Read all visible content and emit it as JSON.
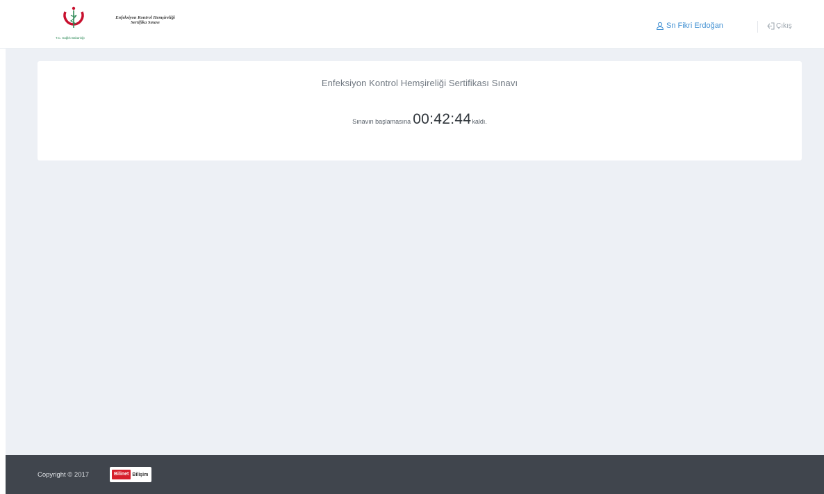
{
  "header": {
    "logo": {
      "title_line1": "Enfeksiyon Kontrol Hemşireliği",
      "title_line2": "Sertifika Sınavı",
      "subtitle": "T.C. Sağlık Bakanlığı",
      "emblem_color": "#c8102e",
      "emblem_accent": "#2d8a57"
    },
    "user": {
      "label": "Sn Fikri Erdoğan",
      "icon": "user-icon"
    },
    "logout": {
      "label": "Çıkış",
      "icon": "logout-icon"
    }
  },
  "main": {
    "card": {
      "title": "Enfeksiyon Kontrol Hemşireliği Sertifikası Sınavı",
      "countdown": {
        "prefix": "Sınavın başlamasına",
        "time": "00:42:44",
        "suffix": "kaldı."
      }
    }
  },
  "footer": {
    "copyright": "Copyright © 2017",
    "brand": {
      "part1": "Bilinet",
      "part2": "Bilişim",
      "color": "#d61f2c"
    }
  },
  "colors": {
    "accent": "#3f8fd2",
    "background": "#edf0f5",
    "footer": "#40454d"
  }
}
